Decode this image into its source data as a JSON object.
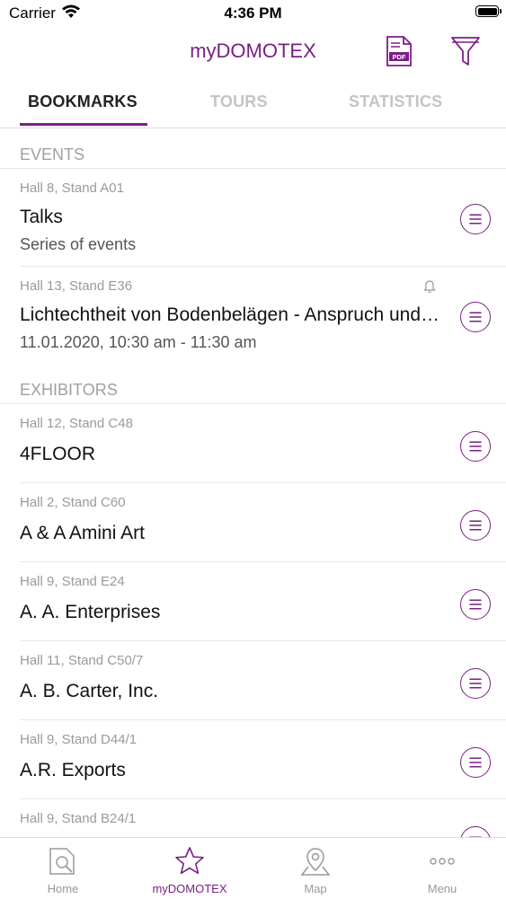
{
  "status": {
    "carrier": "Carrier",
    "time": "4:36 PM"
  },
  "header": {
    "title": "myDOMOTEX",
    "pdf_icon": "pdf-icon",
    "filter_icon": "filter-icon"
  },
  "tabs": [
    {
      "label": "BOOKMARKS",
      "active": true
    },
    {
      "label": "TOURS",
      "active": false
    },
    {
      "label": "STATISTICS",
      "active": false
    }
  ],
  "events": {
    "header": "EVENTS",
    "items": [
      {
        "location": "Hall 8, Stand A01",
        "name": "Talks",
        "subtitle": "Series of events"
      },
      {
        "location": "Hall 13, Stand E36",
        "name": "Lichtechtheit von Bodenbelägen - Anspruch und Realität",
        "subtitle": "11.01.2020, 10:30 am - 11:30 am",
        "bell": true
      }
    ]
  },
  "exhibitors": {
    "header": "EXHIBITORS",
    "items": [
      {
        "location": "Hall 12, Stand C48",
        "name": "4FLOOR"
      },
      {
        "location": "Hall 2, Stand C60",
        "name": "A & A Amini Art"
      },
      {
        "location": "Hall 9, Stand E24",
        "name": "A. A. Enterprises"
      },
      {
        "location": "Hall 11, Stand C50/7",
        "name": "A. B. Carter, Inc."
      },
      {
        "location": "Hall 9, Stand D44/1",
        "name": "A.R. Exports"
      },
      {
        "location": "Hall 9, Stand B24/1",
        "name": ""
      }
    ]
  },
  "tabbar": [
    {
      "label": "Home",
      "icon": "home-search-icon",
      "active": false
    },
    {
      "label": "myDOMOTEX",
      "icon": "star-icon",
      "active": true
    },
    {
      "label": "Map",
      "icon": "map-pin-icon",
      "active": false
    },
    {
      "label": "Menu",
      "icon": "more-dots-icon",
      "active": false
    }
  ],
  "colors": {
    "accent": "#7a1f86",
    "inactive": "#c4c4c4",
    "divider": "#e8e8e8"
  }
}
